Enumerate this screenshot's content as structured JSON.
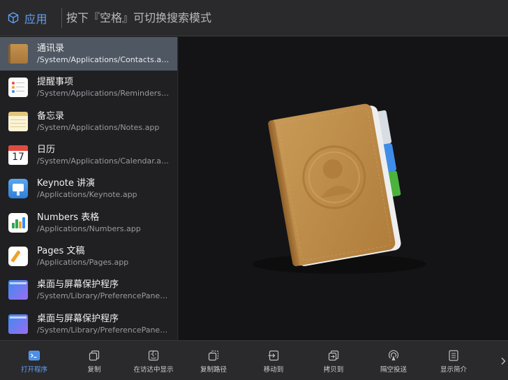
{
  "scope": {
    "label": "应用",
    "icon": "cube-icon"
  },
  "search": {
    "placeholder": "按下『空格』可切换搜索模式",
    "value": ""
  },
  "results": [
    {
      "title": "通讯录",
      "path": "/System/Applications/Contacts.app",
      "icon": "contacts-app-icon",
      "selected": true
    },
    {
      "title": "提醒事项",
      "path": "/System/Applications/Reminders.app",
      "icon": "reminders-app-icon"
    },
    {
      "title": "备忘录",
      "path": "/System/Applications/Notes.app",
      "icon": "notes-app-icon"
    },
    {
      "title": "日历",
      "path": "/System/Applications/Calendar.app",
      "icon": "calendar-app-icon",
      "icon_text": "17"
    },
    {
      "title": "Keynote 讲演",
      "path": "/Applications/Keynote.app",
      "icon": "keynote-app-icon"
    },
    {
      "title": "Numbers 表格",
      "path": "/Applications/Numbers.app",
      "icon": "numbers-app-icon"
    },
    {
      "title": "Pages 文稿",
      "path": "/Applications/Pages.app",
      "icon": "pages-app-icon"
    },
    {
      "title": "桌面与屏幕保护程序",
      "path": "/System/Library/PreferencePanes/D...",
      "icon": "desktop-screensaver-icon"
    },
    {
      "title": "桌面与屏幕保护程序",
      "path": "/System/Library/PreferencePanes/D...",
      "icon": "desktop-screensaver-icon"
    }
  ],
  "preview": {
    "icon": "contacts-large-icon"
  },
  "actions": [
    {
      "label": "打开程序",
      "icon": "terminal-open-icon",
      "active": true
    },
    {
      "label": "复制",
      "icon": "copy-icon"
    },
    {
      "label": "在访达中显示",
      "icon": "finder-icon"
    },
    {
      "label": "复制路径",
      "icon": "copy-path-icon"
    },
    {
      "label": "移动到",
      "icon": "move-to-icon"
    },
    {
      "label": "拷贝到",
      "icon": "copy-to-icon"
    },
    {
      "label": "隔空投送",
      "icon": "airdrop-icon"
    },
    {
      "label": "显示简介",
      "icon": "info-icon"
    }
  ],
  "more": {
    "icon": "chevron-right-icon"
  },
  "colors": {
    "accent": "#62a0f2",
    "selected_row": "#4f5762",
    "background": "#1b1b1d"
  }
}
